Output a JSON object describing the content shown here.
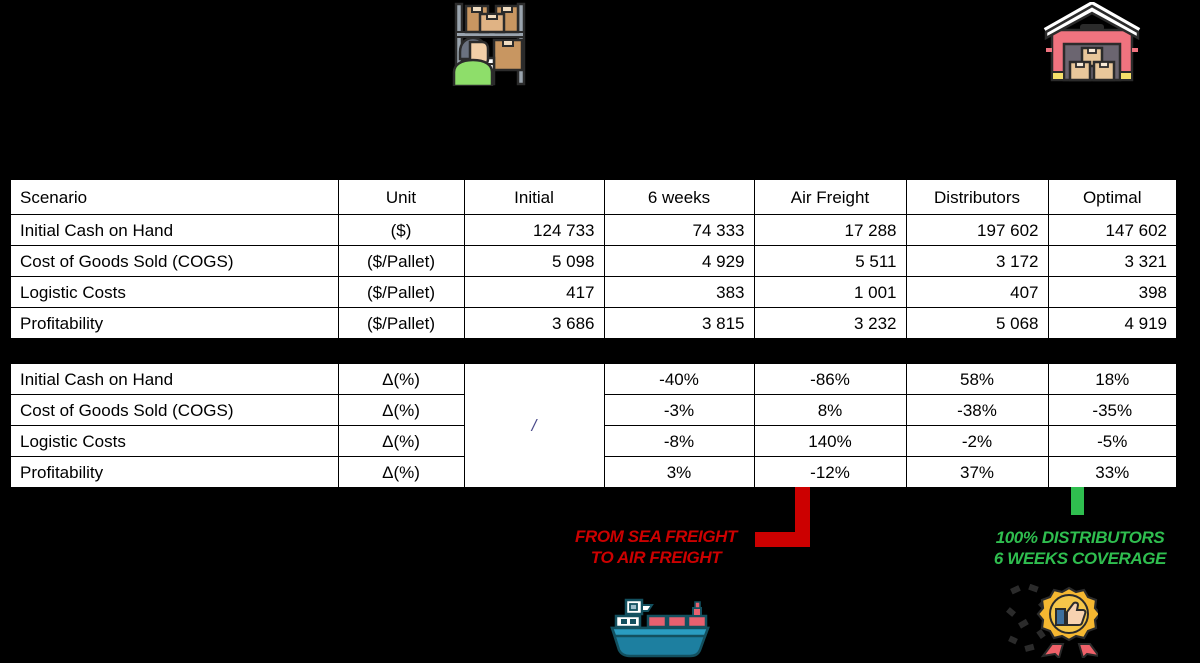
{
  "icons": {
    "warehouse_worker": "warehouse-worker-icon",
    "warehouse_building": "warehouse-building-icon",
    "cargo_ship": "cargo-ship-icon",
    "award_badge": "award-badge-icon"
  },
  "colors": {
    "red": "#EE0000",
    "green": "#27C04B",
    "black": "#000000",
    "connector_red": "#CC0000",
    "connector_green": "#2FBE4F"
  },
  "table_absolute": {
    "headers": [
      "Scenario",
      "Unit",
      "Initial",
      "6 weeks",
      "Air Freight",
      "Distributors",
      "Optimal"
    ],
    "rows": [
      {
        "label": "Initial Cash on Hand",
        "unit": "($)",
        "initial": "124 733",
        "six_weeks": "74 333",
        "air_freight": "17 288",
        "distributors": "197 602",
        "optimal": "147 602"
      },
      {
        "label": "Cost of Goods Sold (COGS)",
        "unit": "($/Pallet)",
        "initial": "5 098",
        "six_weeks": "4 929",
        "air_freight": "5 511",
        "distributors": "3 172",
        "optimal": "3 321"
      },
      {
        "label": "Logistic Costs",
        "unit": "($/Pallet)",
        "initial": "417",
        "six_weeks": "383",
        "air_freight": "1 001",
        "distributors": "407",
        "optimal": "398"
      },
      {
        "label": "Profitability",
        "unit": "($/Pallet)",
        "initial": "3 686",
        "six_weeks": "3 815",
        "air_freight": "3 232",
        "distributors": "5 068",
        "optimal": "4 919"
      }
    ]
  },
  "table_delta": {
    "initial_cell": "/",
    "rows": [
      {
        "label": "Initial Cash on Hand",
        "unit": "Δ(%)",
        "six_weeks": "-40%",
        "air_freight": "-86%",
        "distributors": "58%",
        "optimal": "18%"
      },
      {
        "label": "Cost of Goods Sold (COGS)",
        "unit": "Δ(%)",
        "six_weeks": "-3%",
        "air_freight": "8%",
        "distributors": "-38%",
        "optimal": "-35%"
      },
      {
        "label": "Logistic Costs",
        "unit": "Δ(%)",
        "six_weeks": "-8%",
        "air_freight": "140%",
        "distributors": "-2%",
        "optimal": "-5%"
      },
      {
        "label": "Profitability",
        "unit": "Δ(%)",
        "six_weeks": "3%",
        "air_freight": "-12%",
        "distributors": "37%",
        "optimal": "33%"
      }
    ]
  },
  "annotations": {
    "air_freight": {
      "line1": "FROM SEA FREIGHT",
      "line2": "TO AIR FREIGHT"
    },
    "distributors": {
      "line1": "100% DISTRIBUTORS",
      "line2": "6 WEEKS COVERAGE"
    }
  }
}
